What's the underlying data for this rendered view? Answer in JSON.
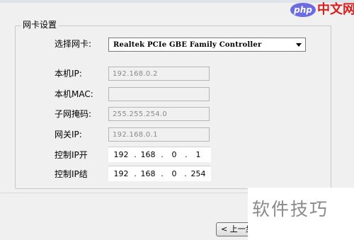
{
  "group": {
    "title": "网卡设置"
  },
  "nic": {
    "label": "选择网卡:",
    "value": "Realtek PCIe GBE Family Controller"
  },
  "fields": [
    {
      "label": "本机IP:",
      "value": "192.168.0.2"
    },
    {
      "label": "本机MAC:",
      "value": ""
    },
    {
      "label": "子网掩码:",
      "value": "255.255.254.0"
    },
    {
      "label": "网关IP:",
      "value": "192.168.0.1"
    }
  ],
  "ip_start": {
    "label": "控制IP开",
    "octets": [
      "192",
      "168",
      "0",
      "1"
    ]
  },
  "ip_end": {
    "label": "控制IP结",
    "octets": [
      "192",
      "168",
      "0",
      "254"
    ]
  },
  "buttons": {
    "prev": "< 上一步"
  },
  "branding": {
    "badge": "php",
    "site": "中文网",
    "watermark": "软件技巧"
  },
  "colors": {
    "badge_bg": "#6c6ce0",
    "site_text": "#d81e1e",
    "watermark": "#8a8a8a"
  }
}
